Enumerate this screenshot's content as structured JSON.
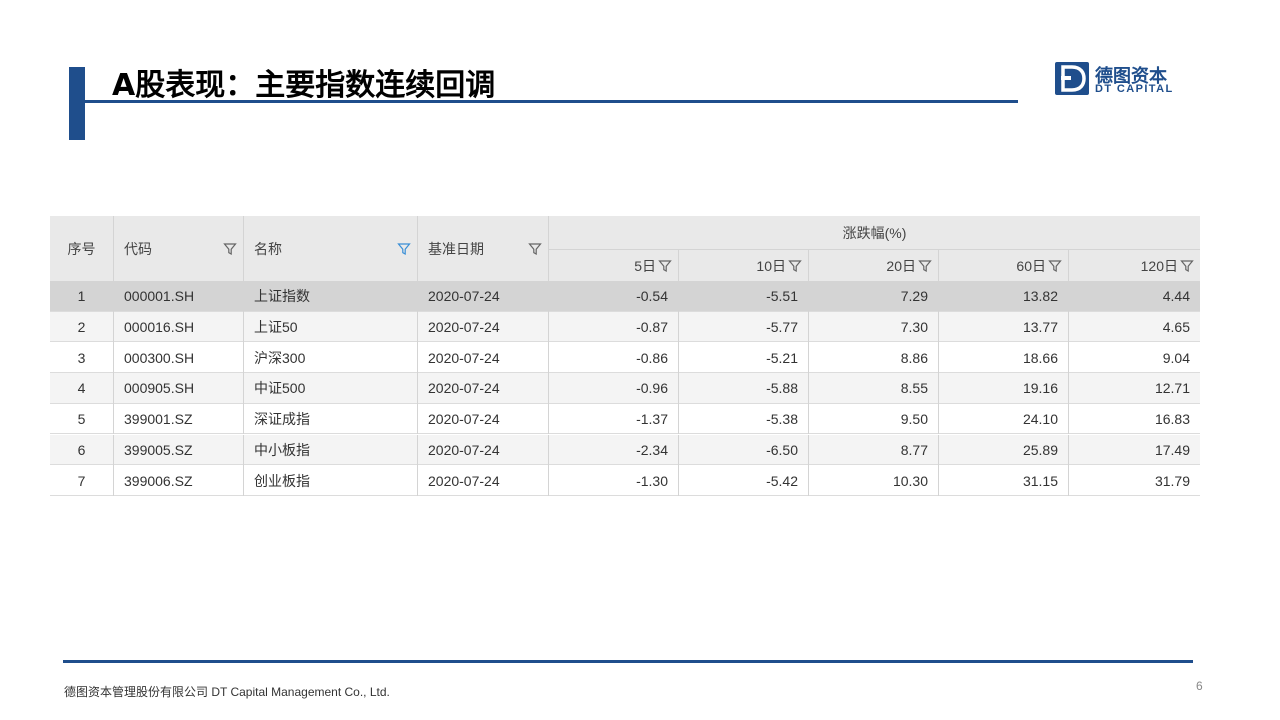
{
  "slide": {
    "title": "A股表现：主要指数连续回调",
    "page_number": "6"
  },
  "logo": {
    "cn": "德图资本",
    "en": "DT CAPITAL",
    "mark_letter": "D"
  },
  "footer": {
    "text": "德图资本管理股份有限公司  DT Capital  Management  Co., Ltd."
  },
  "colors": {
    "brand": "#1f4e8c",
    "header_bg": "#e9e9e9",
    "row_alt": "#f4f4f4",
    "row_selected": "#d4d4d4",
    "filter_icon_active": "#3a8fd6"
  },
  "table": {
    "group_header": "涨跌幅(%)",
    "headers": {
      "seq": "序号",
      "code": "代码",
      "name": "名称",
      "date": "基准日期",
      "d5": "5日",
      "d10": "10日",
      "d20": "20日",
      "d60": "60日",
      "d120": "120日"
    },
    "rows": [
      {
        "seq": "1",
        "code": "000001.SH",
        "name": "上证指数",
        "date": "2020-07-24",
        "d5": "-0.54",
        "d10": "-5.51",
        "d20": "7.29",
        "d60": "13.82",
        "d120": "4.44"
      },
      {
        "seq": "2",
        "code": "000016.SH",
        "name": "上证50",
        "date": "2020-07-24",
        "d5": "-0.87",
        "d10": "-5.77",
        "d20": "7.30",
        "d60": "13.77",
        "d120": "4.65"
      },
      {
        "seq": "3",
        "code": "000300.SH",
        "name": "沪深300",
        "date": "2020-07-24",
        "d5": "-0.86",
        "d10": "-5.21",
        "d20": "8.86",
        "d60": "18.66",
        "d120": "9.04"
      },
      {
        "seq": "4",
        "code": "000905.SH",
        "name": "中证500",
        "date": "2020-07-24",
        "d5": "-0.96",
        "d10": "-5.88",
        "d20": "8.55",
        "d60": "19.16",
        "d120": "12.71"
      },
      {
        "seq": "5",
        "code": "399001.SZ",
        "name": "深证成指",
        "date": "2020-07-24",
        "d5": "-1.37",
        "d10": "-5.38",
        "d20": "9.50",
        "d60": "24.10",
        "d120": "16.83"
      },
      {
        "seq": "6",
        "code": "399005.SZ",
        "name": "中小板指",
        "date": "2020-07-24",
        "d5": "-2.34",
        "d10": "-6.50",
        "d20": "8.77",
        "d60": "25.89",
        "d120": "17.49"
      },
      {
        "seq": "7",
        "code": "399006.SZ",
        "name": "创业板指",
        "date": "2020-07-24",
        "d5": "-1.30",
        "d10": "-5.42",
        "d20": "10.30",
        "d60": "31.15",
        "d120": "31.79"
      }
    ]
  }
}
